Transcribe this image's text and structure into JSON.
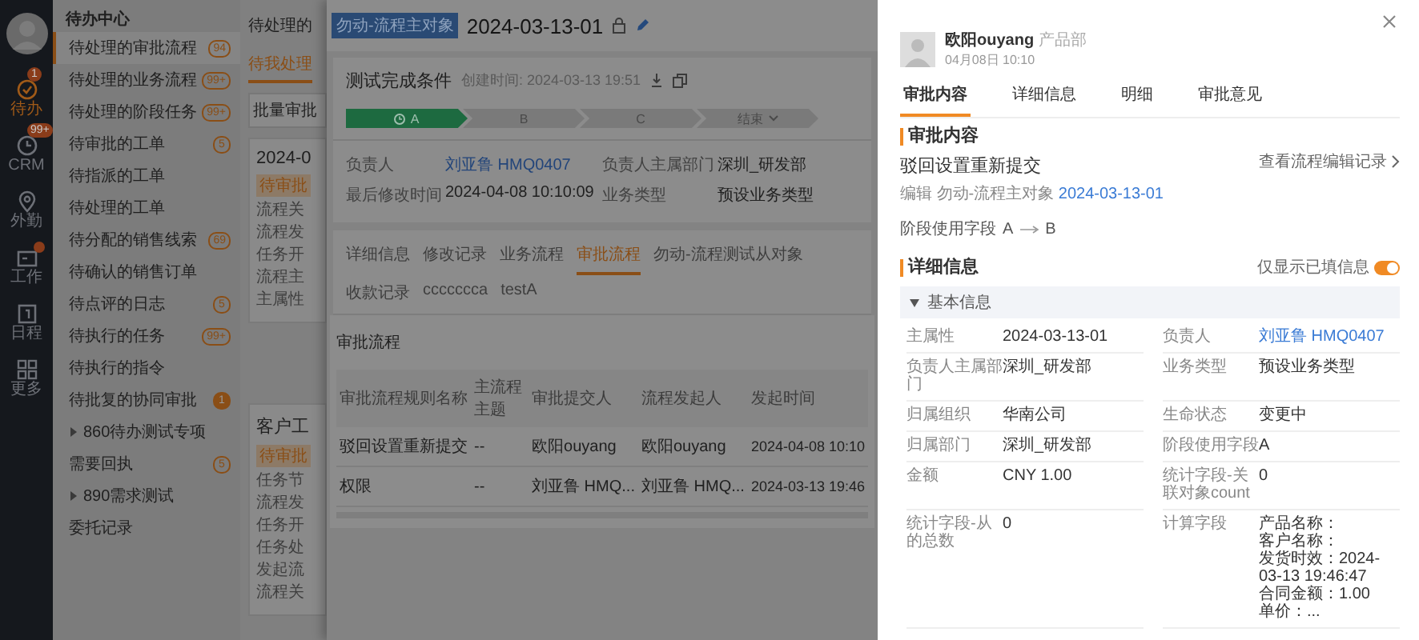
{
  "rail": {
    "items": [
      {
        "label": "待办",
        "selected": true,
        "badge": "1",
        "dot": false
      },
      {
        "label": "CRM",
        "selected": false,
        "badge": "99+",
        "dot": false
      },
      {
        "label": "外勤",
        "selected": false,
        "dot": false
      },
      {
        "label": "工作",
        "selected": false,
        "dot": true
      },
      {
        "label": "日程",
        "selected": false,
        "dot": false
      },
      {
        "label": "更多",
        "selected": false,
        "dot": false
      }
    ]
  },
  "todo": {
    "title": "待办中心",
    "items": [
      {
        "kind": "item",
        "label": "待处理的审批流程",
        "selected": true,
        "count": "94",
        "count_filled": false
      },
      {
        "kind": "item",
        "label": "待处理的业务流程",
        "selected": false,
        "count": "99+",
        "count_filled": false
      },
      {
        "kind": "item",
        "label": "待处理的阶段任务",
        "selected": false,
        "count": "99+",
        "count_filled": false
      },
      {
        "kind": "item",
        "label": "待审批的工单",
        "selected": false,
        "count": "5",
        "count_filled": false
      },
      {
        "kind": "item",
        "label": "待指派的工单",
        "selected": false
      },
      {
        "kind": "item",
        "label": "待处理的工单",
        "selected": false
      },
      {
        "kind": "item",
        "label": "待分配的销售线索",
        "selected": false,
        "count": "69",
        "count_filled": false
      },
      {
        "kind": "item",
        "label": "待确认的销售订单",
        "selected": false
      },
      {
        "kind": "item",
        "label": "待点评的日志",
        "selected": false,
        "count": "5",
        "count_filled": false
      },
      {
        "kind": "item",
        "label": "待执行的任务",
        "selected": false,
        "count": "99+",
        "count_filled": false
      },
      {
        "kind": "item",
        "label": "待执行的指令",
        "selected": false
      },
      {
        "kind": "item",
        "label": "待批复的协同审批",
        "selected": false,
        "count": "1",
        "count_filled": true
      },
      {
        "kind": "group",
        "label": "860待办测试专项",
        "selected": false,
        "expanded": false
      },
      {
        "kind": "item",
        "label": "需要回执",
        "selected": false,
        "count": "5",
        "count_filled": false
      },
      {
        "kind": "group",
        "label": "890需求测试",
        "selected": false,
        "expanded": false
      },
      {
        "kind": "item",
        "label": "委托记录",
        "selected": false
      }
    ]
  },
  "page": {
    "heading": "待处理的",
    "tab": "待我处理",
    "batch_button": "批量审批",
    "cards": [
      {
        "title": "2024-0",
        "status": "待审批",
        "fields": [
          "流程关",
          "流程发",
          "任务开",
          "流程主",
          "主属性"
        ]
      },
      {
        "title": "客户工",
        "status": "待审批",
        "fields": [
          "任务节",
          "流程发",
          "任务开",
          "任务处",
          "发起流",
          "流程关"
        ]
      }
    ]
  },
  "modal": {
    "tag": "勿动-流程主对象",
    "title": "2024-03-13-01",
    "card": {
      "title": "测试完成条件",
      "created": "创建时间: 2024-03-13 19:51",
      "stages": [
        {
          "kind": "step",
          "label": "A",
          "current": true
        },
        {
          "kind": "step",
          "label": "B",
          "current": false
        },
        {
          "kind": "step",
          "label": "C",
          "current": false
        },
        {
          "kind": "dropdown",
          "label": "结束",
          "current": false
        }
      ]
    },
    "fields": [
      {
        "label": "负责人",
        "value": "刘亚鲁 HMQ0407",
        "link": true
      },
      {
        "label": "负责人主属部门",
        "value": "深圳_研发部",
        "link": false
      },
      {
        "label": "最后修改时间",
        "value": "2024-04-08 10:10:09",
        "link": false
      },
      {
        "label": "业务类型",
        "value": "预设业务类型",
        "link": false
      }
    ],
    "tabs": [
      {
        "label": "详细信息",
        "selected": false
      },
      {
        "label": "修改记录",
        "selected": false
      },
      {
        "label": "业务流程",
        "selected": false
      },
      {
        "label": "审批流程",
        "selected": true
      },
      {
        "label": "勿动-流程测试从对象",
        "selected": false
      },
      {
        "label": "收款记录",
        "selected": false
      },
      {
        "label": "ccccccca",
        "selected": false
      },
      {
        "label": "testA",
        "selected": false
      }
    ],
    "section": "审批流程",
    "table": {
      "columns": [
        "审批流程规则名称",
        "主流程主题",
        "审批提交人",
        "流程发起人",
        "发起时间"
      ],
      "rows": [
        [
          "驳回设置重新提交",
          "--",
          "欧阳ouyang",
          "欧阳ouyang",
          "2024-04-08 10:10"
        ],
        [
          "权限",
          "--",
          "刘亚鲁 HMQ...",
          "刘亚鲁 HMQ...",
          "2024-03-13 19:46"
        ]
      ]
    }
  },
  "drawer": {
    "submitter": "欧阳ouyang",
    "department": "产品部",
    "time": "04月08日 10:10",
    "tabs": [
      {
        "label": "审批内容",
        "selected": true
      },
      {
        "label": "详细信息",
        "selected": false
      },
      {
        "label": "明细",
        "selected": false
      },
      {
        "label": "审批意见",
        "selected": false
      }
    ],
    "content": {
      "heading": "审批内容",
      "title": "驳回设置重新提交",
      "history_link": "查看流程编辑记录",
      "summary": "编辑 勿动-流程主对象",
      "summary_link": "2024-03-13-01",
      "stage_label": "阶段使用字段",
      "stage_from": "A",
      "stage_to": "B"
    },
    "details": {
      "heading": "详细信息",
      "filter_label": "仅显示已填信息",
      "filter_on": true,
      "group": {
        "title": "基本信息",
        "expanded": true
      },
      "fields": [
        {
          "label": "主属性",
          "lines": [
            "2024-03-13-01"
          ],
          "link": false
        },
        {
          "label": "负责人",
          "lines": [
            "刘亚鲁 HMQ0407"
          ],
          "link": true
        },
        {
          "label": "负责人主属部门",
          "lines": [
            "深圳_研发部"
          ],
          "link": false
        },
        {
          "label": "业务类型",
          "lines": [
            "预设业务类型"
          ],
          "link": false
        },
        {
          "label": "归属组织",
          "lines": [
            "华南公司"
          ],
          "link": false
        },
        {
          "label": "生命状态",
          "lines": [
            "变更中"
          ],
          "link": false
        },
        {
          "label": "归属部门",
          "lines": [
            "深圳_研发部"
          ],
          "link": false
        },
        {
          "label": "阶段使用字段",
          "lines": [
            "A"
          ],
          "link": false
        },
        {
          "label": "金额",
          "lines": [
            "CNY 1.00"
          ],
          "link": false
        },
        {
          "label": "统计字段-关联对象count",
          "lines": [
            "0"
          ],
          "link": false
        },
        {
          "label": "统计字段-从的总数",
          "lines": [
            "0"
          ],
          "link": false
        },
        {
          "label": "计算字段",
          "lines": [
            "产品名称：",
            "客户名称：",
            "发货时效：2024-03-13 19:46:47",
            "合同金额：1.00",
            "单价：..."
          ],
          "link": false
        }
      ]
    }
  }
}
